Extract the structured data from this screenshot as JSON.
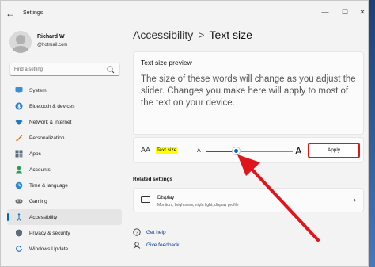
{
  "window": {
    "title": "Settings",
    "back_glyph": "←",
    "min_glyph": "—",
    "max_glyph": "☐",
    "close_glyph": "✕"
  },
  "user": {
    "name": "Richard W",
    "email": "@hotmail.com"
  },
  "search": {
    "placeholder": "Find a setting"
  },
  "nav": {
    "items": [
      {
        "label": "System",
        "icon": "monitor-icon"
      },
      {
        "label": "Bluetooth & devices",
        "icon": "bluetooth-icon"
      },
      {
        "label": "Network & internet",
        "icon": "wifi-icon"
      },
      {
        "label": "Personalization",
        "icon": "brush-icon"
      },
      {
        "label": "Apps",
        "icon": "apps-icon"
      },
      {
        "label": "Accounts",
        "icon": "person-icon"
      },
      {
        "label": "Time & language",
        "icon": "globe-clock-icon"
      },
      {
        "label": "Gaming",
        "icon": "gamepad-icon"
      },
      {
        "label": "Accessibility",
        "icon": "accessibility-icon"
      },
      {
        "label": "Privacy & security",
        "icon": "shield-icon"
      },
      {
        "label": "Windows Update",
        "icon": "update-icon"
      }
    ],
    "active": "Accessibility"
  },
  "breadcrumb": {
    "parent": "Accessibility",
    "separator": ">",
    "current": "Text size"
  },
  "preview": {
    "title": "Text size preview",
    "text": "The size of these words will change as you adjust the slider. Changes you make here will apply to most of the text on your device."
  },
  "text_size": {
    "icon_text": "AA",
    "label": "Text size",
    "small_a": "A",
    "large_a": "A",
    "slider_fraction": 0.3,
    "apply_label": "Apply"
  },
  "related": {
    "heading": "Related settings",
    "display_title": "Display",
    "display_subtitle": "Monitors, brightness, night light, display profile",
    "chevron": "›"
  },
  "links": {
    "get_help": "Get help",
    "give_feedback": "Give feedback"
  },
  "colors": {
    "accent": "#0067c0",
    "annotation_red": "#e0141b",
    "highlight": "#ffff00"
  }
}
